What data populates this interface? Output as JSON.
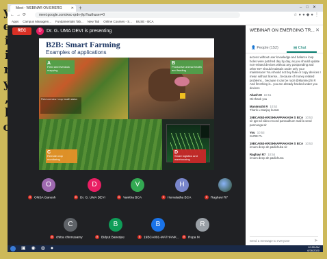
{
  "background_letters": [
    "y",
    "e",
    "i",
    "i",
    "r",
    "y",
    ",",
    "l",
    "o"
  ],
  "browser": {
    "tab_title": "Meet - WEBINAR ON EMERG",
    "url": "meet.google.com/wsc-qrdv-jhp?authuser=0",
    "bookmarks": [
      "Apps",
      "Campus Managem...",
      "Fundamentals Tab...",
      "New Tab",
      "Online Courses - S...",
      "BUSE - BCA"
    ]
  },
  "meet": {
    "rec_label": "REC",
    "presenter_initial": "D",
    "presenting_text": "Dr. G. UMA DEVI is presenting"
  },
  "slide": {
    "title": "B2B: Smart Farming",
    "subtitle": "Examples of applications",
    "boxes": [
      {
        "letter": "A",
        "text": "Field and livestock mapping"
      },
      {
        "letter": "B",
        "text": "Productive animal health and feeding"
      },
      {
        "letter": "C",
        "text": "Remote crop monitoring"
      },
      {
        "letter": "D",
        "text": "Smart logistics and warehousing"
      }
    ],
    "field_overlay": "Field overview / crop health status"
  },
  "participants": [
    {
      "initial": "O",
      "name": "ONSA Ganesh",
      "color": "#9e69af"
    },
    {
      "initial": "D",
      "name": "Dr. G. UMA DEVI",
      "color": "#e91e63"
    },
    {
      "initial": "V",
      "name": "Vanitha BCA",
      "color": "#33a852"
    },
    {
      "initial": "H",
      "name": "Hemalatha BCA",
      "color": "#7986cb"
    },
    {
      "initial": "",
      "name": "Raghavi R7",
      "color": "#5f6368"
    },
    {
      "initial": "C",
      "name": "chitra chinnusamy",
      "color": "#5f6368"
    },
    {
      "initial": "B",
      "name": "Bidyut Banerjee",
      "color": "#0f9d58"
    },
    {
      "initial": "B",
      "name": "19BCA091-MATHANK...",
      "color": "#1a73e8"
    },
    {
      "initial": "R",
      "name": "Rupa M",
      "color": "#9aa0a6"
    }
  ],
  "panel": {
    "title": "WEBINAR ON EMERGING TR...",
    "people_tab": "People (152)",
    "chat_tab": "Chat",
    "compose_placeholder": "Send a message to everyone",
    "messages": [
      {
        "author": "",
        "time": "",
        "text": "access without user knowledge and balance loop holes were patched day by day, as you should update non-related devices without any postponding and other IOT should maintain under only your maintenace! You should not buy fake or copy devices I mean without license... because of money related problems... because it can be root! @Manimozhi R And first thing is.. you are already hacked under you devices"
      },
      {
        "author": "Akash M",
        "time": "10:51",
        "text": "Ok thank you"
      },
      {
        "author": "Manimozhi R",
        "time": "10:52",
        "text": "Thank u Sanjay kumar"
      },
      {
        "author": "19BCA063-KRISHNAPRAKASH S BCA",
        "time": "10:53",
        "text": "sir ppt nd video record pannadhum mail la send pannunga sir"
      },
      {
        "author": "You",
        "time": "10:53",
        "text": "SURE PL"
      },
      {
        "author": "19BCA063-KRISHNAPRAKASH S BCA",
        "time": "10:53",
        "text": "innum deep ah padichuka sir"
      },
      {
        "author": "Raghavi R7",
        "time": "10:54",
        "text": "innum deep ah padichuna"
      }
    ]
  },
  "taskbar": {
    "time": "10:55 AM",
    "date": "6/26/2020"
  }
}
